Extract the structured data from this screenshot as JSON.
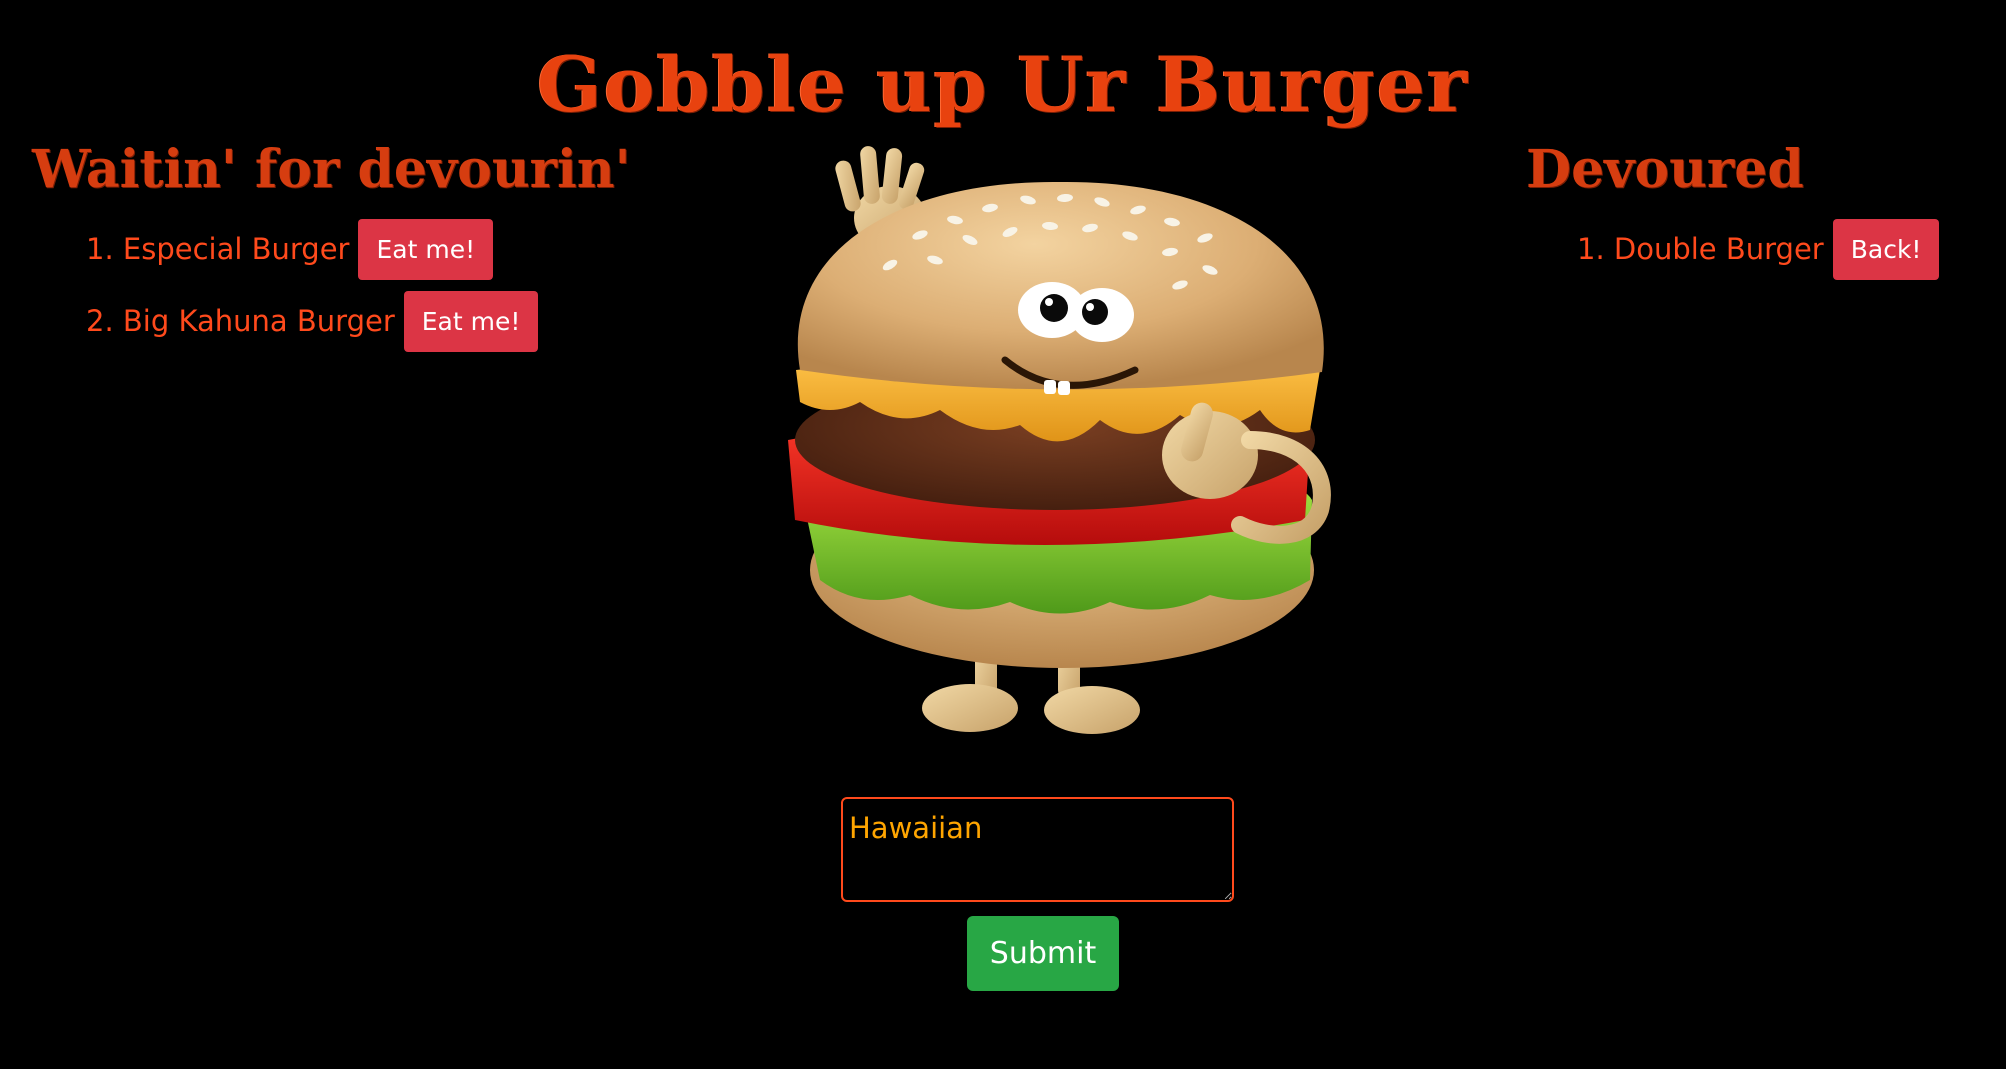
{
  "page": {
    "title": "Gobble up Ur Burger"
  },
  "waiting": {
    "heading": "Waitin' for devourin'",
    "items": [
      {
        "number": "1.",
        "name": "Especial Burger",
        "button_label": "Eat me!"
      },
      {
        "number": "2.",
        "name": "Big Kahuna Burger",
        "button_label": "Eat me!"
      }
    ]
  },
  "devoured": {
    "heading": "Devoured",
    "items": [
      {
        "number": "1.",
        "name": "Double Burger",
        "button_label": "Back!"
      }
    ]
  },
  "form": {
    "input_value": "Hawaiian",
    "submit_label": "Submit"
  },
  "icons": {
    "mascot": "waving-burger-mascot"
  },
  "colors": {
    "background": "#000000",
    "text_accent": "#ff4a1c",
    "button_danger": "#dc3545",
    "button_success": "#28a745",
    "input_text": "#ffa500"
  }
}
